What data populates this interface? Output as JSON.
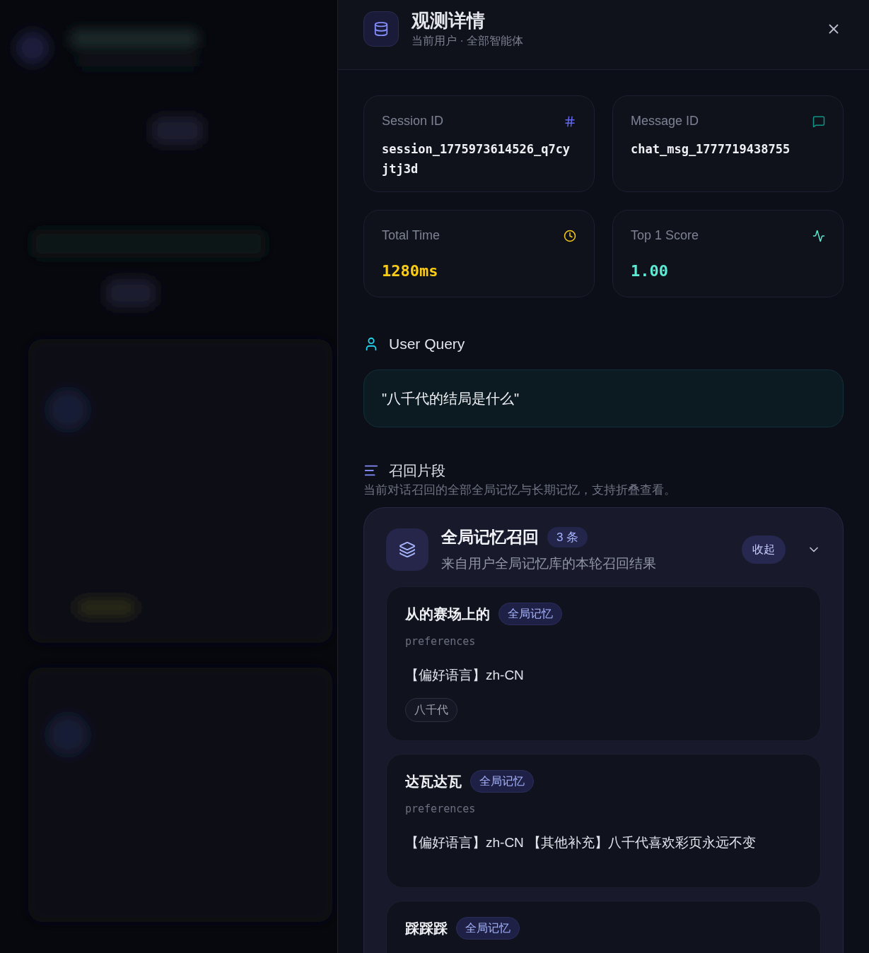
{
  "panel": {
    "title": "观测详情",
    "subtitle": "当前用户 · 全部智能体"
  },
  "stats": [
    {
      "label": "Session ID",
      "value": "session_1775973614526_q7cyjtj3d",
      "kind": "hash",
      "color": "#6366f1"
    },
    {
      "label": "Message ID",
      "value": "chat_msg_1777719438755",
      "kind": "message",
      "color": "#0d9488"
    },
    {
      "label": "Total Time",
      "value": "1280ms",
      "kind": "clock",
      "color": "#facc15"
    },
    {
      "label": "Top 1 Score",
      "value": "1.00",
      "kind": "activity",
      "color": "#5eead4"
    }
  ],
  "query": {
    "heading": "User Query",
    "text": "\"八千代的结局是什么\""
  },
  "recall": {
    "heading": "召回片段",
    "description": "当前对话召回的全部全局记忆与长期记忆，支持折叠查看。",
    "group": {
      "title": "全局记忆召回",
      "count": "3 条",
      "subtitle": "来自用户全局记忆库的本轮召回结果",
      "action": "收起",
      "expanded": true,
      "items": [
        {
          "title": "从的赛场上的",
          "badge": "全局记忆",
          "category": "preferences",
          "content": "【偏好语言】zh-CN",
          "tags": [
            "八千代"
          ]
        },
        {
          "title": "达瓦达瓦",
          "badge": "全局记忆",
          "category": "preferences",
          "content": "【偏好语言】zh-CN 【其他补充】八千代喜欢彩页永远不变"
        },
        {
          "title": "踩踩踩",
          "badge": "全局记忆"
        }
      ]
    }
  }
}
